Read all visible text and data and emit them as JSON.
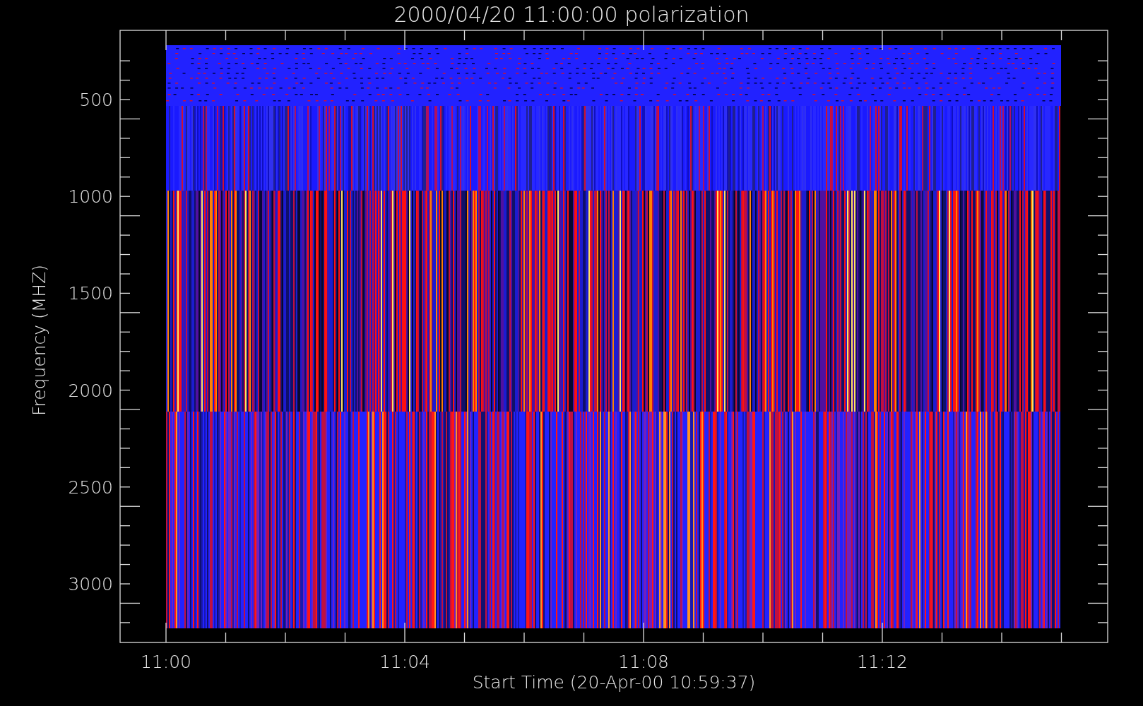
{
  "title": "2000/04/20 11:00:00 polarization",
  "ylabel": "Frequency (MHZ)",
  "xlabel": "Start Time (20-Apr-00 10:59:37)",
  "yticks": [
    "500",
    "1000",
    "1500",
    "2000",
    "2500",
    "3000"
  ],
  "xticks": [
    "11:00",
    "11:04",
    "11:08",
    "11:12"
  ]
}
